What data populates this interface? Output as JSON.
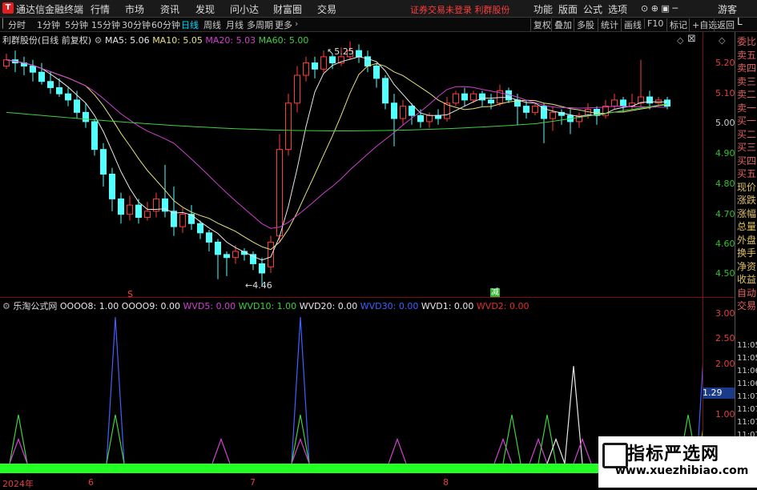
{
  "window": {
    "app_title": "通达信金融终端",
    "menu": [
      "行情",
      "市场",
      "资讯",
      "发现",
      "问小达",
      "财富圈",
      "交易"
    ],
    "notice": "证券交易未登录  利群股份",
    "right_menu": [
      "功能",
      "版面",
      "公式",
      "选项"
    ],
    "guest": "游客"
  },
  "toolbar": {
    "periods": [
      "分时",
      "1分钟",
      "5分钟",
      "15分钟",
      "30分钟",
      "60分钟",
      "日线",
      "周线",
      "月线",
      "多周期",
      "更多"
    ],
    "active_period": "日线",
    "buttons": [
      "复权",
      "叠加",
      "多股",
      "统计",
      "画线",
      "F10",
      "标记",
      "+自选",
      "返回"
    ]
  },
  "main_chart": {
    "legend_stock": "利群股份(日线 前复权)",
    "legend_ma": [
      {
        "label": "MA5: 5.06",
        "color": "#e8e8e8"
      },
      {
        "label": "MA10: 5.05",
        "color": "#e8e080"
      },
      {
        "label": "MA20: 5.03",
        "color": "#d040d0"
      },
      {
        "label": "MA60: 5.00",
        "color": "#40d040"
      }
    ],
    "annot_high": "5.25",
    "annot_low": "4.46",
    "marker_s": "S",
    "marker_reduce": "减"
  },
  "sub_chart": {
    "indicator_name": "乐淘公式网",
    "legend": [
      {
        "label": "OOOO8: 1.00",
        "color": "#e8e8e8"
      },
      {
        "label": "OOOO9: 0.00",
        "color": "#e8e8e8"
      },
      {
        "label": "WVD5: 0.00",
        "color": "#d040d0"
      },
      {
        "label": "WVD10: 1.00",
        "color": "#40d040"
      },
      {
        "label": "WVD20: 0.00",
        "color": "#e8e8e8"
      },
      {
        "label": "WVD30: 0.00",
        "color": "#4060ff"
      },
      {
        "label": "WVD1: 0.00",
        "color": "#e8e8e8"
      },
      {
        "label": "WVD2: 0.00",
        "color": "#e03030"
      }
    ],
    "current_value": "1.29",
    "dates": [
      "2024年",
      "6",
      "7",
      "8"
    ]
  },
  "axis": {
    "main_ticks": [
      "5.20",
      "5.10",
      "5.00",
      "4.90",
      "4.80",
      "4.70",
      "4.60",
      "4.50"
    ],
    "sub_ticks": [
      "3.00",
      "2.50",
      "2.00",
      "1.00"
    ]
  },
  "side_panel": {
    "top_label": "L",
    "labels": [
      "委比",
      "卖五",
      "卖四",
      "卖三",
      "卖二",
      "卖一",
      "买一",
      "买二",
      "买三",
      "买四",
      "买五",
      "现价",
      "涨跌",
      "涨幅",
      "总量",
      "外盘",
      "换手",
      "净资",
      "收益",
      "自动",
      "交易"
    ],
    "times": [
      "11:05",
      "11:05",
      "11:06",
      "11:06",
      "11:07",
      "11:07",
      "11:07",
      "11:07",
      "11:07",
      "11:07",
      "11:07"
    ]
  },
  "chart_data": {
    "type": "candlestick",
    "candles": [
      [
        5.17,
        5.19,
        5.21,
        5.16
      ],
      [
        5.19,
        5.18,
        5.22,
        5.15
      ],
      [
        5.18,
        5.17,
        5.2,
        5.14
      ],
      [
        5.17,
        5.15,
        5.19,
        5.12
      ],
      [
        5.15,
        5.12,
        5.18,
        5.11
      ],
      [
        5.12,
        5.1,
        5.15,
        5.08
      ],
      [
        5.1,
        5.08,
        5.13,
        5.07
      ],
      [
        5.08,
        5.06,
        5.1,
        5.04
      ],
      [
        5.06,
        5.02,
        5.09,
        5.0
      ],
      [
        5.02,
        4.99,
        5.05,
        4.97
      ],
      [
        4.99,
        4.9,
        5.0,
        4.88
      ],
      [
        4.9,
        4.82,
        4.92,
        4.78
      ],
      [
        4.82,
        4.74,
        4.84,
        4.7
      ],
      [
        4.74,
        4.69,
        4.76,
        4.66
      ],
      [
        4.69,
        4.72,
        4.75,
        4.67
      ],
      [
        4.72,
        4.68,
        4.74,
        4.66
      ],
      [
        4.68,
        4.7,
        4.73,
        4.67
      ],
      [
        4.7,
        4.74,
        4.76,
        4.68
      ],
      [
        4.74,
        4.7,
        4.85,
        4.68
      ],
      [
        4.7,
        4.65,
        4.78,
        4.62
      ],
      [
        4.65,
        4.69,
        4.71,
        4.63
      ],
      [
        4.69,
        4.66,
        4.72,
        4.64
      ],
      [
        4.66,
        4.63,
        4.67,
        4.61
      ],
      [
        4.63,
        4.6,
        4.64,
        4.57
      ],
      [
        4.6,
        4.56,
        4.61,
        4.48
      ],
      [
        4.56,
        4.55,
        4.57,
        4.49
      ],
      [
        4.55,
        4.57,
        4.59,
        4.53
      ],
      [
        4.57,
        4.56,
        4.58,
        4.54
      ],
      [
        4.56,
        4.53,
        4.57,
        4.51
      ],
      [
        4.53,
        4.5,
        4.55,
        4.46
      ],
      [
        4.52,
        4.6,
        4.62,
        4.5
      ],
      [
        4.62,
        4.9,
        4.95,
        4.6
      ],
      [
        4.9,
        5.05,
        5.08,
        4.88
      ],
      [
        5.05,
        5.14,
        5.17,
        5.02
      ],
      [
        5.14,
        5.18,
        5.2,
        5.12
      ],
      [
        5.18,
        5.16,
        5.2,
        5.13
      ],
      [
        5.16,
        5.2,
        5.22,
        5.15
      ],
      [
        5.2,
        5.18,
        5.21,
        5.16
      ],
      [
        5.18,
        5.2,
        5.23,
        5.17
      ],
      [
        5.2,
        5.22,
        5.25,
        5.19
      ],
      [
        5.22,
        5.2,
        5.24,
        5.18
      ],
      [
        5.2,
        5.17,
        5.22,
        5.15
      ],
      [
        5.17,
        5.13,
        5.18,
        5.1
      ],
      [
        5.13,
        5.05,
        5.14,
        5.03
      ],
      [
        5.05,
        5.0,
        5.08,
        4.91
      ],
      [
        5.0,
        5.04,
        5.06,
        4.98
      ],
      [
        5.04,
        5.01,
        5.05,
        4.98
      ],
      [
        5.01,
        4.99,
        5.03,
        4.97
      ],
      [
        4.99,
        5.01,
        5.02,
        4.97
      ],
      [
        5.01,
        5.0,
        5.03,
        4.98
      ],
      [
        5.0,
        5.05,
        5.07,
        4.99
      ],
      [
        5.05,
        5.08,
        5.09,
        5.04
      ],
      [
        5.08,
        5.06,
        5.1,
        5.04
      ],
      [
        5.06,
        5.08,
        5.09,
        5.05
      ],
      [
        5.08,
        5.06,
        5.09,
        5.04
      ],
      [
        5.06,
        5.05,
        5.08,
        5.03
      ],
      [
        5.05,
        5.09,
        5.11,
        5.04
      ],
      [
        5.09,
        5.06,
        5.1,
        5.05
      ],
      [
        5.06,
        5.04,
        5.08,
        4.98
      ],
      [
        5.04,
        5.02,
        5.06,
        5.0
      ],
      [
        5.02,
        5.04,
        5.05,
        5.01
      ],
      [
        5.04,
        5.0,
        5.05,
        4.92
      ],
      [
        5.0,
        5.02,
        5.04,
        4.96
      ],
      [
        5.02,
        5.01,
        5.03,
        4.98
      ],
      [
        5.01,
        4.99,
        5.03,
        4.95
      ],
      [
        4.99,
        5.01,
        5.02,
        4.97
      ],
      [
        5.01,
        5.03,
        5.05,
        5.0
      ],
      [
        5.03,
        5.01,
        5.04,
        4.98
      ],
      [
        5.01,
        5.04,
        5.06,
        5.0
      ],
      [
        5.04,
        5.06,
        5.08,
        5.03
      ],
      [
        5.06,
        5.04,
        5.07,
        5.02
      ],
      [
        5.04,
        5.05,
        5.08,
        5.03
      ],
      [
        5.05,
        5.07,
        5.19,
        5.04
      ],
      [
        5.07,
        5.05,
        5.09,
        5.03
      ],
      [
        5.05,
        5.06,
        5.07,
        5.04
      ],
      [
        5.06,
        5.04,
        5.07,
        5.03
      ]
    ],
    "ylim": [
      4.43,
      5.28
    ],
    "ma_colors": [
      "#e8e8e8",
      "#e8e080",
      "#d040d0",
      "#40d040"
    ],
    "indicator": {
      "ylim": [
        0,
        3.2
      ],
      "spikes": [
        {
          "i": 1,
          "v": 1.0,
          "c": "#40d040"
        },
        {
          "i": 1,
          "v": 0.5,
          "c": "#d040d0"
        },
        {
          "i": 12,
          "v": 3.0,
          "c": "#4060ff"
        },
        {
          "i": 12,
          "v": 1.0,
          "c": "#40d040"
        },
        {
          "i": 24,
          "v": 0.5,
          "c": "#d040d0"
        },
        {
          "i": 33,
          "v": 3.0,
          "c": "#4060ff"
        },
        {
          "i": 33,
          "v": 1.0,
          "c": "#40d040"
        },
        {
          "i": 33,
          "v": 0.5,
          "c": "#d040d0"
        },
        {
          "i": 44,
          "v": 0.5,
          "c": "#d040d0"
        },
        {
          "i": 56,
          "v": 0.5,
          "c": "#d040d0"
        },
        {
          "i": 57,
          "v": 1.0,
          "c": "#40d040"
        },
        {
          "i": 60,
          "v": 0.5,
          "c": "#d040d0"
        },
        {
          "i": 61,
          "v": 1.0,
          "c": "#40d040"
        },
        {
          "i": 62,
          "v": 0.5,
          "c": "#e8e8e8"
        },
        {
          "i": 64,
          "v": 2.0,
          "c": "#e8e8e8"
        },
        {
          "i": 65,
          "v": 0.5,
          "c": "#d040d0"
        },
        {
          "i": 77,
          "v": 1.0,
          "c": "#40d040"
        },
        {
          "i": 79,
          "v": 3.0,
          "c": "#4060ff"
        },
        {
          "i": 79,
          "v": 1.0,
          "c": "#40d040"
        }
      ]
    }
  }
}
